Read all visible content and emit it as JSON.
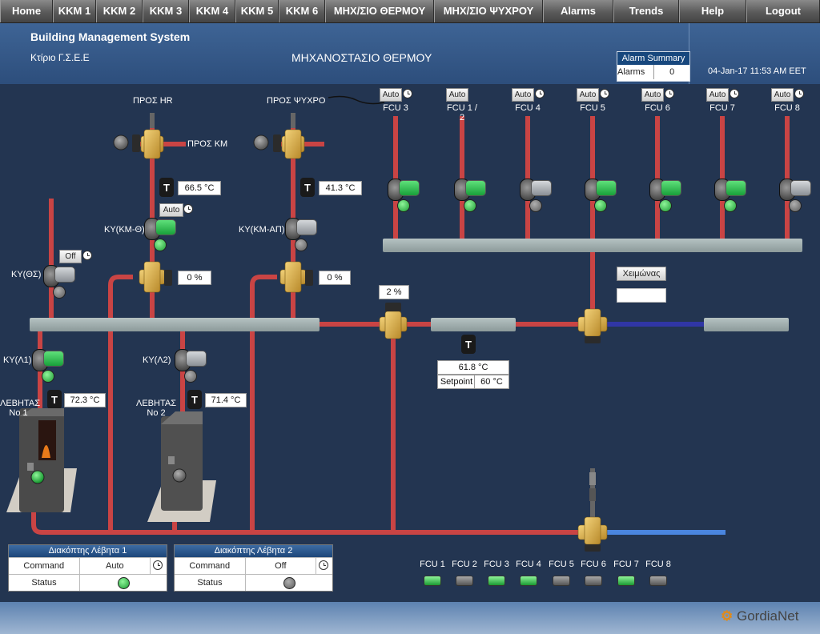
{
  "nav": [
    "Home",
    "KKM 1",
    "KKM 2",
    "KKM 3",
    "KKM 4",
    "KKM 5",
    "KKM 6",
    "ΜΗΧ/ΣΙΟ ΘΕΡΜΟΥ",
    "ΜΗΧ/ΣΙΟ ΨΥΧΡΟΥ",
    "Alarms",
    "Trends",
    "Help",
    "Logout"
  ],
  "header": {
    "title": "Building Management System",
    "site": "Κτίριο Γ.Σ.Ε.Ε",
    "page": "ΜΗΧΑΝΟΣΤΑΣΙΟ ΘΕΡΜΟΥ",
    "alarm_summary": "Alarm Summary",
    "alarms_label": "Alarms",
    "alarms_count": "0",
    "datetime": "04-Jan-17 11:53 AM EET"
  },
  "labels": {
    "pros_hr": "ΠΡΟΣ HR",
    "pros_psyxro": "ΠΡΟΣ ΨΥΧΡΟ",
    "pros_km": "ΠΡΟΣ ΚΜ",
    "ky_km_th": "ΚΥ(ΚΜ-Θ)",
    "ky_km_ap": "ΚΥ(ΚΜ-ΑΠ)",
    "ky_ths": "ΚΥ(ΘΣ)",
    "ky_l1": "ΚΥ(Λ1)",
    "ky_l2": "ΚΥ(Λ2)",
    "boiler1": "ΛΕΒΗΤΑΣ\nNo 1",
    "boiler2": "ΛΕΒΗΤΑΣ\nNo 2",
    "season": "Χειμώνας",
    "setpoint_label": "Setpoint"
  },
  "values": {
    "hr_temp": "66.5 °C",
    "psyxro_temp": "41.3 °C",
    "valve_hr": "0 %",
    "valve_psyxro": "0 %",
    "valve_mix": "2 %",
    "mix_temp": "61.8 °C",
    "setpoint": "60 °C",
    "boiler1_temp": "72.3 °C",
    "boiler2_temp": "71.4 °C",
    "ky_km_th_mode": "Auto",
    "ky_ths_mode": "Off"
  },
  "fcus": [
    {
      "label": "FCU 3",
      "mode": "Auto",
      "schedule": true,
      "on": true
    },
    {
      "label": "FCU 1 / 2",
      "mode": "Auto",
      "schedule": false,
      "on": true
    },
    {
      "label": "FCU 4",
      "mode": "Auto",
      "schedule": true,
      "on": false
    },
    {
      "label": "FCU 5",
      "mode": "Auto",
      "schedule": true,
      "on": true
    },
    {
      "label": "FCU 6",
      "mode": "Auto",
      "schedule": true,
      "on": true
    },
    {
      "label": "FCU 7",
      "mode": "Auto",
      "schedule": true,
      "on": true
    },
    {
      "label": "FCU 8",
      "mode": "Auto",
      "schedule": true,
      "on": false
    }
  ],
  "fcu_status": [
    {
      "label": "FCU 1",
      "on": true
    },
    {
      "label": "FCU 2",
      "on": false
    },
    {
      "label": "FCU 3",
      "on": true
    },
    {
      "label": "FCU 4",
      "on": true
    },
    {
      "label": "FCU 5",
      "on": false
    },
    {
      "label": "FCU 6",
      "on": false
    },
    {
      "label": "FCU 7",
      "on": true
    },
    {
      "label": "FCU 8",
      "on": false
    }
  ],
  "panels": [
    {
      "title": "Διακόπτης Λέβητα 1",
      "command_label": "Command",
      "command": "Auto",
      "status_label": "Status",
      "on": true
    },
    {
      "title": "Διακόπτης Λέβητα 2",
      "command_label": "Command",
      "command": "Off",
      "status_label": "Status",
      "on": false
    }
  ],
  "colors": {
    "pipe_hot": "#c94444",
    "pipe_cold": "#3a6fd1",
    "pump_on": "#22b14c",
    "pump_off": "#7a7a7a",
    "bg": "#233551"
  },
  "logo": "GordiaNet"
}
